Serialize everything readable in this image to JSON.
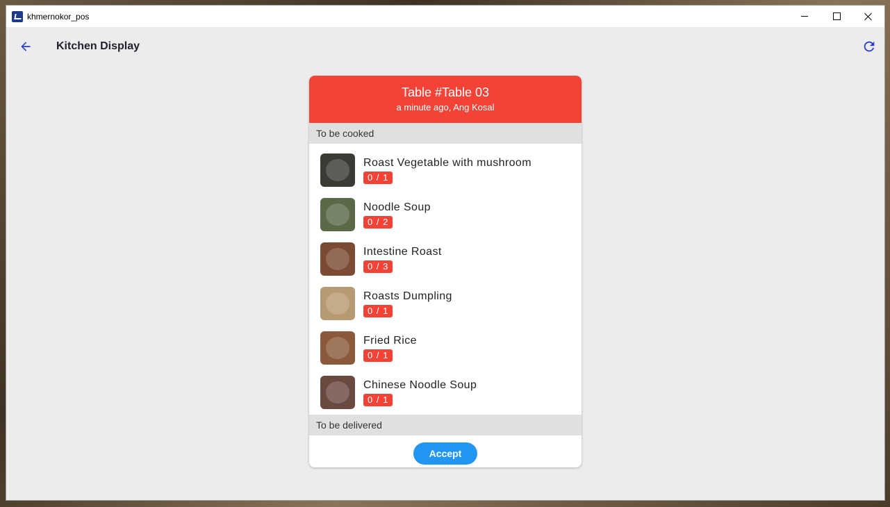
{
  "window": {
    "title": "khmernokor_pos"
  },
  "appbar": {
    "title": "Kitchen Display",
    "back_icon": "arrow-back-icon",
    "refresh_icon": "refresh-icon"
  },
  "order": {
    "table_title": "Table #Table 03",
    "subtitle": "a minute ago, Ang Kosal",
    "to_cook_label": "To be cooked",
    "to_deliver_label": "To be delivered",
    "accept_label": "Accept",
    "items": [
      {
        "name": "Roast Vegetable with mushroom",
        "qty": "0 / 1",
        "thumb_color": "#3b3a34"
      },
      {
        "name": "Noodle Soup",
        "qty": "0 / 2",
        "thumb_color": "#5a6a48"
      },
      {
        "name": "Intestine Roast",
        "qty": "0 / 3",
        "thumb_color": "#7a4a32"
      },
      {
        "name": "Roasts Dumpling",
        "qty": "0 / 1",
        "thumb_color": "#b89a72"
      },
      {
        "name": "Fried Rice",
        "qty": "0 / 1",
        "thumb_color": "#8a5a3a"
      },
      {
        "name": "Chinese Noodle Soup",
        "qty": "0 / 1",
        "thumb_color": "#6a4a40"
      }
    ]
  },
  "colors": {
    "header_red": "#f44336",
    "badge_red": "#f44336",
    "accent_blue": "#2196f3",
    "icon_blue": "#2a3fd0"
  }
}
